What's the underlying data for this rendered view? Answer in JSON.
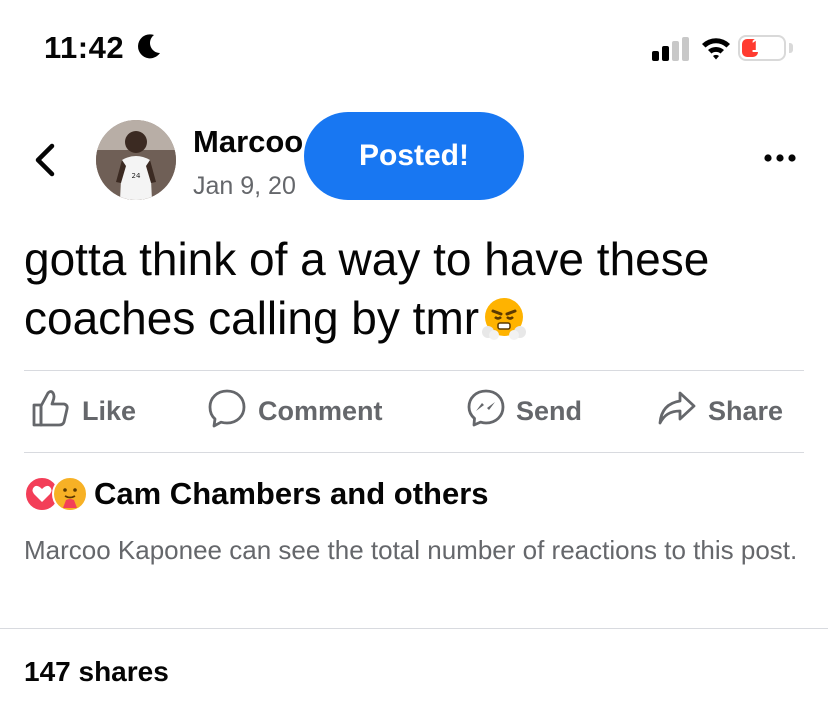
{
  "status": {
    "time": "11:42",
    "battery": "12",
    "battery_level": 0.12
  },
  "post": {
    "author": "Marcoo",
    "date": "Jan 9, 20",
    "toast": "Posted!",
    "text": "gotta think of a way to have these coaches calling by tmr"
  },
  "actions": {
    "like": "Like",
    "comment": "Comment",
    "send": "Send",
    "share": "Share"
  },
  "reactions": {
    "names": "Cam Chambers and others",
    "info": "Marcoo Kaponee can see the total number of reactions to this post."
  },
  "shares": "147 shares",
  "colors": {
    "accent": "#1877f2",
    "muted": "#65676b",
    "battery_low": "#ff3b30"
  },
  "icons": [
    "moon-icon",
    "cellular-signal-icon",
    "wifi-icon",
    "battery-icon",
    "back-chevron-icon",
    "more-icon",
    "like-icon",
    "comment-icon",
    "messenger-icon",
    "share-icon",
    "love-reaction-icon",
    "care-reaction-icon",
    "triumph-emoji"
  ]
}
